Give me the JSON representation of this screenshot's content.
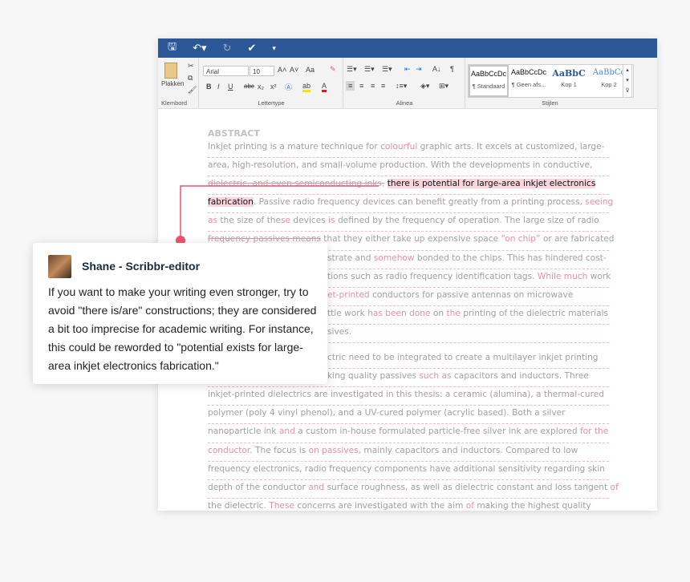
{
  "quick_access": {
    "icons": [
      "save-icon",
      "undo-icon",
      "redo-icon",
      "check-icon",
      "customize-icon"
    ]
  },
  "ribbon": {
    "clipboard": {
      "paste_label": "Plakken",
      "group_label": "Klembord"
    },
    "font": {
      "font_name": "Arial",
      "font_size": "10",
      "change_case": "Aa",
      "group_label": "Lettertype",
      "bold": "B",
      "italic": "I",
      "underline": "U",
      "strike": "abc",
      "sub": "x₂",
      "sup": "x²"
    },
    "paragraph": {
      "group_label": "Alinea",
      "pilcrow": "¶"
    },
    "styles": {
      "group_label": "Stijlen",
      "items": [
        {
          "preview": "AaBbCcDc",
          "name": "¶ Standaard"
        },
        {
          "preview": "AaBbCcDc",
          "name": "¶ Geen afs..."
        },
        {
          "preview": "AaBbC",
          "name": "Kop 1"
        },
        {
          "preview": "AaBbCc",
          "name": "Kop 2"
        }
      ]
    }
  },
  "document": {
    "heading": "ABSTRACT",
    "lines": [
      [
        [
          "n",
          "Inkjet printing is a mature technique for "
        ],
        [
          "r",
          "colourful"
        ],
        [
          "n",
          " graphic arts. It excels at customized, large-"
        ]
      ],
      [
        [
          "n",
          "area, high-resolution, and small-volume production. With the developments in conductive,"
        ]
      ],
      [
        [
          "del",
          "dielectric, and even semiconducting inks,"
        ],
        [
          "n",
          " "
        ],
        [
          "hl",
          "there is potential for large-area inkjet electronics"
        ]
      ],
      [
        [
          "hl",
          "fabrication"
        ],
        [
          "n",
          ". Passive radio frequency devices can benefit greatly from a printing process"
        ],
        [
          "r",
          ", seeing"
        ]
      ],
      [
        [
          "r",
          "as"
        ],
        [
          "n",
          " the size of the"
        ],
        [
          "r",
          "se"
        ],
        [
          "n",
          " devices "
        ],
        [
          "r",
          "is"
        ],
        [
          "n",
          " defined by the frequency of operation. The large size of radio"
        ]
      ],
      [
        [
          "del",
          "frequency passives means"
        ],
        [
          "n",
          " that they either take up expensive space "
        ],
        [
          "r",
          "“on chip”"
        ],
        [
          "n",
          " or are fabricated"
        ]
      ],
      [
        [
          "n",
          "strate and "
        ],
        [
          "r",
          "somehow"
        ],
        [
          "n",
          " bonded to the chips. This has hindered cost-"
        ]
      ],
      [
        [
          "n",
          "tions such as radio frequency identification tags. "
        ],
        [
          "r",
          "While much"
        ],
        [
          "n",
          " work"
        ]
      ],
      [
        [
          "r",
          "et-printed"
        ],
        [
          "n",
          " conductors for passive antennas on microwave"
        ]
      ],
      [
        [
          "n",
          "ttle work "
        ],
        [
          "r",
          "has been done"
        ],
        [
          "n",
          " on "
        ],
        [
          "r",
          "the"
        ],
        [
          "n",
          " printing of the dielectric materials"
        ]
      ],
      [
        [
          "n",
          "sives."
        ]
      ],
      [
        [
          "n",
          "ctric need to be integrated to create a multilayer inkjet printing"
        ]
      ],
      [
        [
          "n",
          "king quality passives "
        ],
        [
          "r",
          "such as"
        ],
        [
          "n",
          " capacitors and inductors. Three"
        ]
      ],
      [
        [
          "n",
          "inkjet-printed dielectrics are investigated in this thesis: a ceramic (alumina), a thermal-cured"
        ]
      ],
      [
        [
          "n",
          "polymer (poly 4 vinyl phenol), and a UV-cured polymer (acrylic based). Both a silver"
        ]
      ],
      [
        [
          "n",
          "nanoparticle ink "
        ],
        [
          "r",
          "and"
        ],
        [
          "n",
          " a custom in-house formulated particle-free silver ink are explored "
        ],
        [
          "r",
          "for the"
        ]
      ],
      [
        [
          "r",
          "conductor"
        ],
        [
          "n",
          ". The focus is "
        ],
        [
          "r",
          "on passives,"
        ],
        [
          "n",
          " mainly capacitors and inductors. Compared to low"
        ]
      ],
      [
        [
          "n",
          "frequency electronics, radio frequency components have additional sensitivity regarding skin"
        ]
      ],
      [
        [
          "n",
          "depth of the conductor "
        ],
        [
          "r",
          "and"
        ],
        [
          "n",
          " surface roughness, as well as dielectric constant and loss tangent "
        ],
        [
          "r",
          "of"
        ]
      ],
      [
        [
          "n",
          "the dielectric. "
        ],
        [
          "r",
          "These"
        ],
        [
          "n",
          " concerns are investigated with the aim "
        ],
        [
          "r",
          "of"
        ],
        [
          "n",
          " making the highest quality"
        ]
      ]
    ]
  },
  "comment": {
    "author": "Shane - Scribbr-editor",
    "text": "If you want to make your writing even stronger, try to avoid \"there is/are\" constructions; they are considered a bit too imprecise for academic writing. For instance, this could be reworded to \"potential exists for large-area inkjet electronics fabrication.\"",
    "accent_color": "#f0506e"
  }
}
